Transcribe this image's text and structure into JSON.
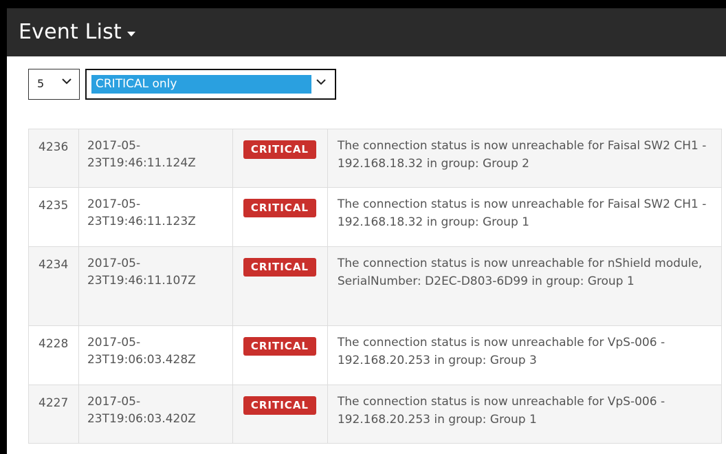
{
  "header": {
    "title": "Event List"
  },
  "filters": {
    "count": {
      "value": "5"
    },
    "level": {
      "value": "CRITICAL only"
    }
  },
  "events": [
    {
      "id": "4236",
      "time_line1": "2017-05-",
      "time_line2": "23T19:46:11.124Z",
      "severity": "CRITICAL",
      "message": "The connection status is now unreachable for Faisal SW2 CH1 - 192.168.18.32 in group: Group 2"
    },
    {
      "id": "4235",
      "time_line1": "2017-05-",
      "time_line2": "23T19:46:11.123Z",
      "severity": "CRITICAL",
      "message": "The connection status is now unreachable for Faisal SW2 CH1 - 192.168.18.32 in group: Group 1"
    },
    {
      "id": "4234",
      "time_line1": "2017-05-",
      "time_line2": "23T19:46:11.107Z",
      "severity": "CRITICAL",
      "message": "The connection status is now unreachable for nShield module, SerialNumber: D2EC-D803-6D99 in group: Group 1"
    },
    {
      "id": "4228",
      "time_line1": "2017-05-",
      "time_line2": "23T19:06:03.428Z",
      "severity": "CRITICAL",
      "message": "The connection status is now unreachable for VpS-006 - 192.168.20.253 in group: Group 3"
    },
    {
      "id": "4227",
      "time_line1": "2017-05-",
      "time_line2": "23T19:06:03.420Z",
      "severity": "CRITICAL",
      "message": "The connection status is now unreachable for VpS-006 - 192.168.20.253 in group: Group 1"
    }
  ],
  "colors": {
    "header_bg": "#2b2b2b",
    "critical": "#c9302c",
    "select_highlight": "#2aa0e0"
  }
}
